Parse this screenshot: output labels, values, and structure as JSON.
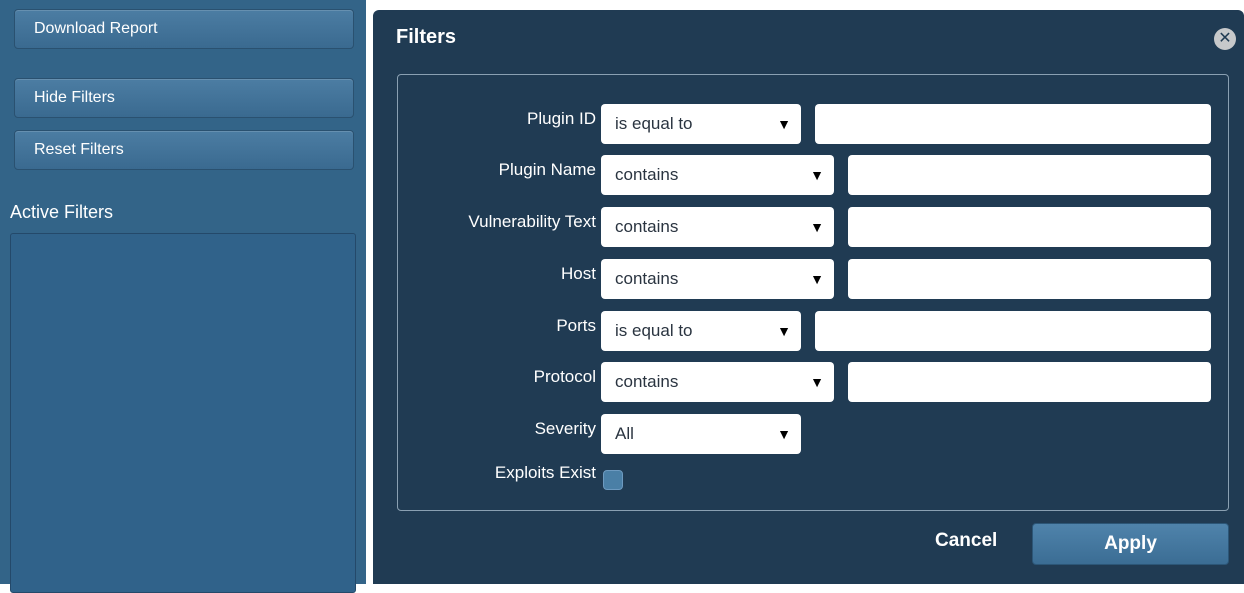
{
  "sidebar": {
    "download_label": "Download Report",
    "hide_filters_label": "Hide Filters",
    "reset_filters_label": "Reset Filters",
    "active_filters_label": "Active Filters"
  },
  "panel": {
    "title": "Filters",
    "close_icon": "close-icon",
    "filters": [
      {
        "label": "Plugin ID",
        "operator": "is equal to",
        "value": ""
      },
      {
        "label": "Plugin Name",
        "operator": "contains",
        "value": ""
      },
      {
        "label": "Vulnerability Text",
        "operator": "contains",
        "value": ""
      },
      {
        "label": "Host",
        "operator": "contains",
        "value": ""
      },
      {
        "label": "Ports",
        "operator": "is equal to",
        "value": ""
      },
      {
        "label": "Protocol",
        "operator": "contains",
        "value": ""
      },
      {
        "label": "Severity",
        "operator": "All"
      },
      {
        "label": "Exploits Exist",
        "checked": false
      }
    ],
    "cancel_label": "Cancel",
    "apply_label": "Apply"
  },
  "colors": {
    "sidebar_bg": "#336488",
    "panel_bg": "#203b53",
    "button_bg": "#4c7da3"
  }
}
